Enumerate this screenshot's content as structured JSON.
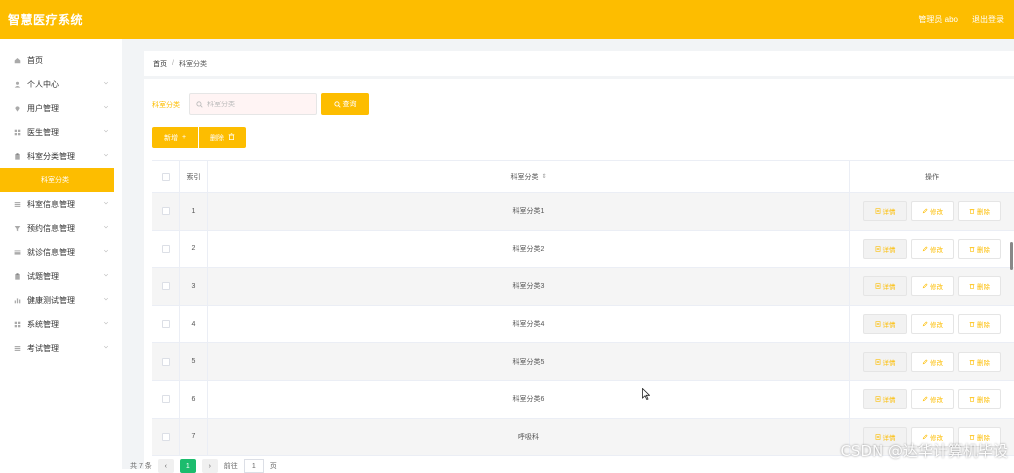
{
  "app": {
    "title": "智慧医疗系统"
  },
  "topbar": {
    "user": "管理员 abo",
    "logout": "退出登录"
  },
  "sidebar": {
    "items": [
      {
        "label": "首页",
        "icon": "home-icon",
        "has_children": false
      },
      {
        "label": "个人中心",
        "icon": "user-icon",
        "has_children": true
      },
      {
        "label": "用户管理",
        "icon": "location-icon",
        "has_children": true
      },
      {
        "label": "医生管理",
        "icon": "grid-icon",
        "has_children": true
      },
      {
        "label": "科室分类管理",
        "icon": "clipboard-icon",
        "has_children": true,
        "expanded": true,
        "children": [
          {
            "label": "科室分类",
            "active": true
          }
        ]
      },
      {
        "label": "科室信息管理",
        "icon": "menu-icon",
        "has_children": true
      },
      {
        "label": "预约信息管理",
        "icon": "filter-icon",
        "has_children": true
      },
      {
        "label": "就诊信息管理",
        "icon": "card-icon",
        "has_children": true
      },
      {
        "label": "试题管理",
        "icon": "clipboard-icon",
        "has_children": true
      },
      {
        "label": "健康测试管理",
        "icon": "chart-icon",
        "has_children": true
      },
      {
        "label": "系统管理",
        "icon": "grid-icon",
        "has_children": true
      },
      {
        "label": "考试管理",
        "icon": "menu-icon",
        "has_children": true
      }
    ]
  },
  "breadcrumb": {
    "home": "首页",
    "separator": "/",
    "current": "科室分类"
  },
  "search": {
    "label": "科室分类",
    "placeholder": "科室分类",
    "button": "查询"
  },
  "actions": {
    "add": "新增",
    "add_symbol": "+",
    "delete": "删除"
  },
  "table": {
    "headers": {
      "index": "索引",
      "name": "科室分类",
      "sort": "⇕",
      "ops": "操作"
    },
    "op_labels": {
      "detail": "详情",
      "edit": "修改",
      "remove": "删除"
    },
    "rows": [
      {
        "index": "1",
        "name": "科室分类1"
      },
      {
        "index": "2",
        "name": "科室分类2"
      },
      {
        "index": "3",
        "name": "科室分类3"
      },
      {
        "index": "4",
        "name": "科室分类4"
      },
      {
        "index": "5",
        "name": "科室分类5"
      },
      {
        "index": "6",
        "name": "科室分类6"
      },
      {
        "index": "7",
        "name": "呼吸科"
      }
    ]
  },
  "pagination": {
    "total": "共 7 条",
    "prev": "‹",
    "page": "1",
    "next": "›",
    "goto": "前往",
    "goto_value": "1",
    "unit": "页"
  },
  "watermark": "CSDN @达华计算机毕设",
  "colors": {
    "accent": "#fdbd00",
    "active_page": "#1cbc6d"
  }
}
